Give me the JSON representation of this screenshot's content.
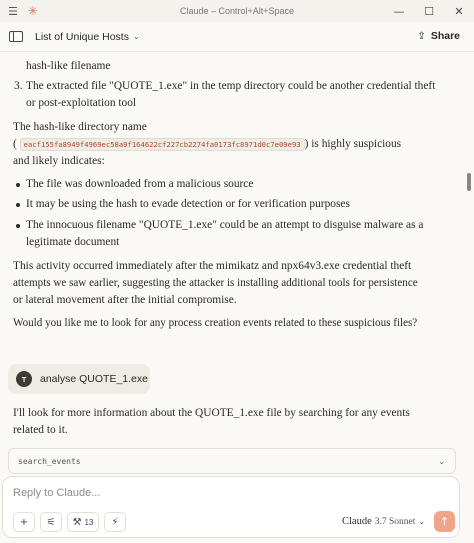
{
  "window": {
    "title": "Claude – Control+Alt+Space",
    "controls": {
      "minimize": "—",
      "maximize": "☐",
      "close": "✕"
    }
  },
  "header": {
    "chat_title": "List of Unique Hosts",
    "share_label": "Share"
  },
  "message": {
    "list_item_tail": "hash-like filename",
    "item3_number": "3.",
    "item3_line1": "The extracted file \"QUOTE_1.exe\" in the temp directory could be another credential theft",
    "item3_line2": "or post-exploitation tool",
    "hash_intro": "The hash-like directory name",
    "hash_open_paren": "(",
    "hash_value": "eacf155fa8949f4969ec58a9f164622cf227cb2274fa0173fc8971d0c7e09e93",
    "hash_tail": ") is highly suspicious",
    "hash_line2": "and likely indicates:",
    "bullets": [
      "The file was downloaded from a malicious source",
      "It may be using the hash to evade detection or for verification purposes",
      "The innocuous filename \"QUOTE_1.exe\" could be an attempt to disguise malware as a",
      "legitimate document"
    ],
    "para_line1": "This activity occurred immediately after the mimikatz and npx64v3.exe credential theft",
    "para_line2": "attempts we saw earlier, suggesting the attacker is installing additional tools for persistence",
    "para_line3": "or lateral movement after the initial compromise.",
    "question": "Would you like me to look for any process creation events related to these suspicious files?"
  },
  "user_message": {
    "avatar_initial": "T",
    "text": "analyse QUOTE_1.exe"
  },
  "reply": {
    "line1": "I'll look for more information about the QUOTE_1.exe file by searching for any events",
    "line2": "related to it."
  },
  "tool_call": {
    "name": "search_events"
  },
  "composer": {
    "placeholder": "Reply to Claude...",
    "tools_count": "13",
    "model_name": "Claude",
    "model_version": "3.7 Sonnet"
  },
  "colors": {
    "background": "#faf9f5",
    "accent": "#d97757",
    "send_button": "#f0a58a",
    "code_text": "#b4442f"
  }
}
